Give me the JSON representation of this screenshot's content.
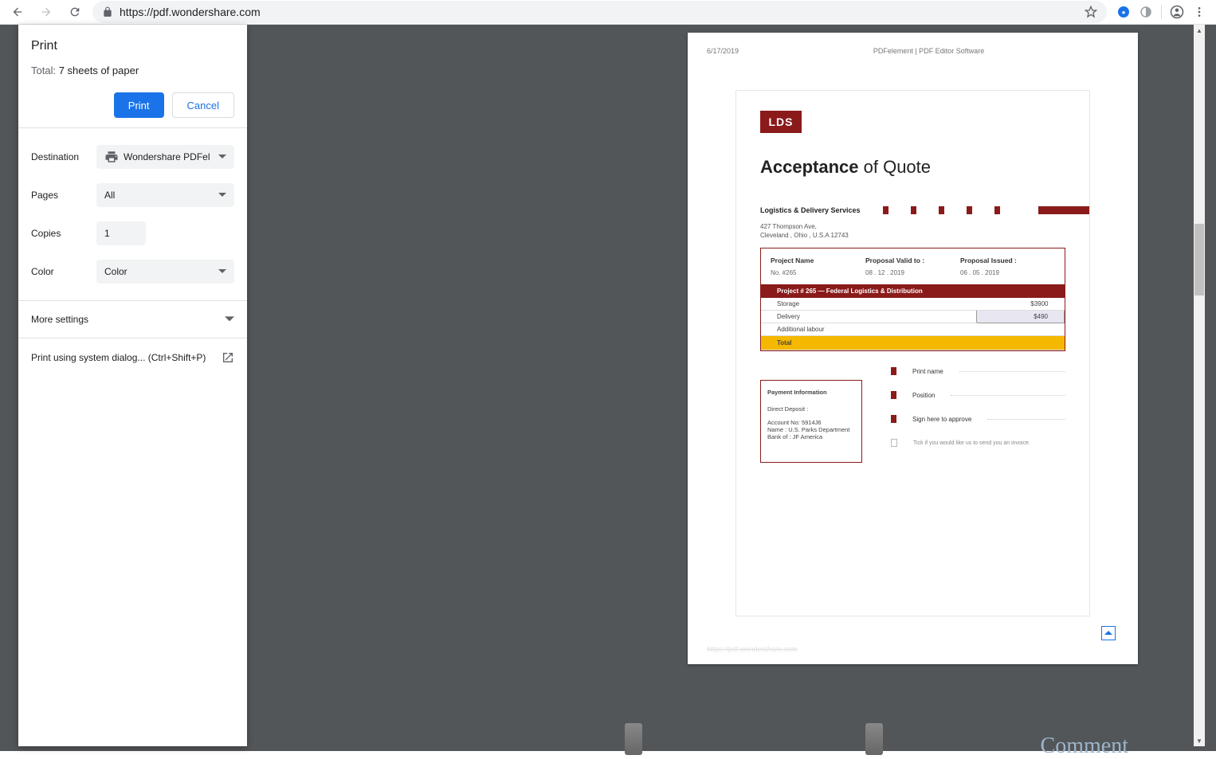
{
  "browser": {
    "url": "https://pdf.wondershare.com"
  },
  "print": {
    "title": "Print",
    "total_prefix": "Total: ",
    "total_value": "7 sheets of paper",
    "btn_print": "Print",
    "btn_cancel": "Cancel",
    "destination_label": "Destination",
    "destination_value": "Wondershare PDFel",
    "pages_label": "Pages",
    "pages_value": "All",
    "copies_label": "Copies",
    "copies_value": "1",
    "color_label": "Color",
    "color_value": "Color",
    "more_settings": "More settings",
    "system_dialog": "Print using system dialog... (Ctrl+Shift+P)"
  },
  "doc": {
    "date": "6/17/2019",
    "header_title": "PDFelement | PDF Editor Software",
    "logo": "LDS",
    "title_bold": "Acceptance",
    "title_light": " of Quote",
    "company": "Logistics & Delivery Services",
    "addr1": "427 Thompson Ave,",
    "addr2": "Cleveland , Ohio , U.S.A 12743",
    "col1_h": "Project Name",
    "col2_h": "Proposal Valid to :",
    "col3_h": "Proposal Issued :",
    "col1_v": "No. #265",
    "col2_v": "08 . 12 . 2019",
    "col3_v": "06 . 05 . 2019",
    "project_bar": "Project # 265 — Federal Logistics & Distribution",
    "line1_label": "Storage",
    "line1_amt": "$3900",
    "line2_label": "Delivery",
    "line2_amt": "$490",
    "line3_label": "Additional labour",
    "total_label": "Total",
    "pay_title": "Payment Information",
    "pay_sub": "Direct Deposit :",
    "pay_l1": "Account No: 5914J6",
    "pay_l2": "Name :  U.S. Parks Department",
    "pay_l3": "Bank of : JF America",
    "sign_name": "Print name",
    "sign_position": "Position",
    "sign_approve": "Sign here to approve",
    "tick_text": "Tick if you would like us to send you an invoice.",
    "footer_url": "https://pdf.wondershare.com",
    "comment_peek": "Comment"
  }
}
